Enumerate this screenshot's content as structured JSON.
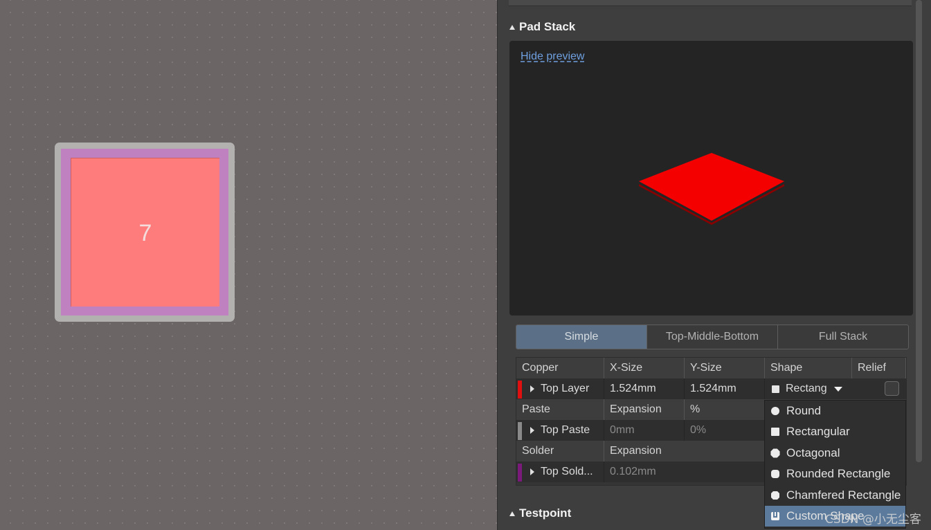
{
  "canvas": {
    "pad_number": "7",
    "colors": {
      "background": "#6b6665",
      "copper": "#ff7c7c",
      "solder_mask": "#c081c0",
      "outline": "#b3b0b0"
    }
  },
  "panel": {
    "pad_stack_header": "Pad Stack",
    "hide_preview_link": "Hide preview",
    "preview_color": "#f50000",
    "mode_tabs": [
      {
        "label": "Simple",
        "active": true
      },
      {
        "label": "Top-Middle-Bottom",
        "active": false
      },
      {
        "label": "Full Stack",
        "active": false
      }
    ],
    "table": {
      "copper_header": {
        "col1": "Copper",
        "col2": "X-Size",
        "col3": "Y-Size",
        "col4": "Shape",
        "col5": "Relief"
      },
      "copper_row": {
        "layer": "Top Layer",
        "x_size": "1.524mm",
        "y_size": "1.524mm",
        "shape": "Rectang",
        "layer_color": "#e01010"
      },
      "paste_header": {
        "col1": "Paste",
        "col2": "Expansion",
        "col3": "%"
      },
      "paste_row": {
        "layer": "Top Paste",
        "expansion": "0mm",
        "percent": "0%",
        "layer_color": "#8a8a8a"
      },
      "solder_header": {
        "col1": "Solder",
        "col2": "Expansion"
      },
      "solder_row": {
        "layer": "Top Sold...",
        "expansion": "0.102mm",
        "layer_color": "#7a1a7a"
      }
    },
    "shape_dropdown": {
      "options": [
        {
          "label": "Round",
          "icon": "circle-icon"
        },
        {
          "label": "Rectangular",
          "icon": "square-icon"
        },
        {
          "label": "Octagonal",
          "icon": "octagon-icon"
        },
        {
          "label": "Rounded Rectangle",
          "icon": "rounded-rect-icon"
        },
        {
          "label": "Chamfered Rectangle",
          "icon": "chamfered-rect-icon"
        },
        {
          "label": "Custom Shape",
          "icon": "custom-shape-icon",
          "selected": true
        }
      ]
    },
    "testpoint_header": "Testpoint"
  },
  "watermark": "CSDN @小无尘客"
}
